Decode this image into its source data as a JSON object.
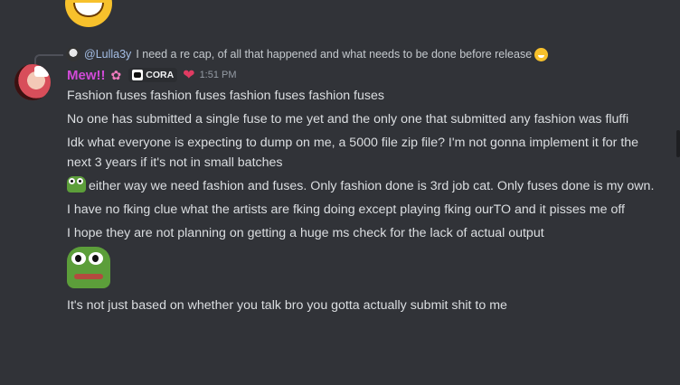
{
  "reply": {
    "author": "@Lulla3y",
    "text": "I need a re cap, of all that happened and what needs to be done before release",
    "emoji": "grinning-sweat-emoji"
  },
  "message": {
    "author": "Mew!!",
    "guild_tag": "CORA",
    "timestamp": "1:51 PM",
    "author_color": "#d04ad7",
    "lines": [
      "Fashion fuses fashion fuses fashion fuses fashion fuses",
      "No one has submitted a single fuse to me yet and the only one that submitted any fashion was fluffi",
      "Idk what everyone is expecting to dump on me, a 5000 file zip file? I'm not gonna implement it for the next 3 years if it's not in small batches",
      "either way we need fashion and fuses. Only fashion done is 3rd job cat. Only fuses done is my own.",
      "I have no fking clue what the artists are fking doing except playing fking ourTO and it pisses me off",
      "I hope they are not planning on getting a huge ms check for the lack of actual output",
      "It's not just based on whether you talk bro you gotta actually submit shit to me"
    ]
  },
  "icons": {
    "flower": "flower-emoji",
    "heart": "heart-emoji",
    "pepe": "pepe-emoji"
  }
}
